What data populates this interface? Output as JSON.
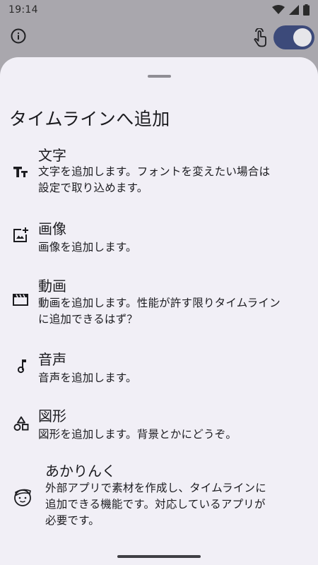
{
  "status_bar": {
    "time": "19:14",
    "icons": [
      "wifi-icon",
      "signal-icon",
      "battery-icon"
    ]
  },
  "app_bar": {
    "left_icon": "info-icon",
    "right_icon": "touch-icon",
    "toggle_on": true
  },
  "sheet": {
    "title": "タイムラインへ追加",
    "items": [
      {
        "icon": "text-icon",
        "title": "文字",
        "desc_lines": [
          "文字を追加します。フォントを変えたい場合は",
          "設定で取り込めます。"
        ]
      },
      {
        "icon": "image-add-icon",
        "title": "画像",
        "desc_lines": [
          "画像を追加します。"
        ]
      },
      {
        "icon": "movie-icon",
        "title": "動画",
        "desc_lines": [
          "動画を追加します。性能が許す限りタイムライン",
          "に追加できるはず？"
        ]
      },
      {
        "icon": "music-note-icon",
        "title": "音声",
        "desc_lines": [
          "音声を追加します。"
        ]
      },
      {
        "icon": "shapes-icon",
        "title": "図形",
        "desc_lines": [
          "図形を追加します。背景とかにどうぞ。"
        ]
      },
      {
        "icon": "face-icon",
        "title": "あかりんく",
        "desc_lines": [
          "外部アプリで素材を作成し、タイムラインに",
          "追加できる機能です。対応しているアプリが",
          "必要です。"
        ]
      }
    ]
  },
  "colors": {
    "scrim": "#a9a7ad",
    "sheet_bg": "#f1eff6",
    "toggle_track": "#3c4a7a",
    "text": "#1b1b1f"
  }
}
